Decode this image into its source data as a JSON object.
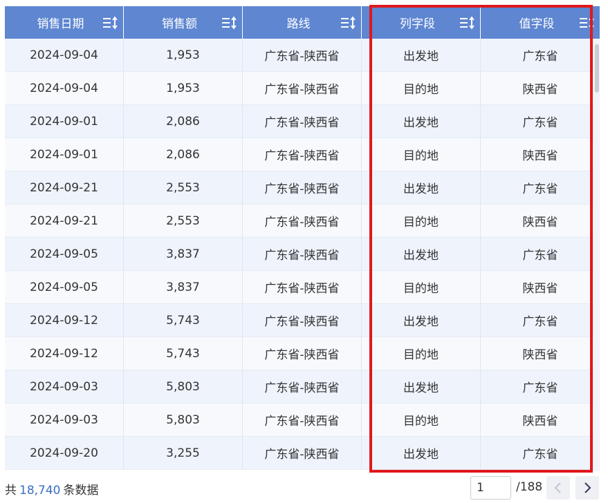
{
  "table": {
    "columns": [
      {
        "label": "销售日期",
        "sort_icon": "sort-icon"
      },
      {
        "label": "销售额",
        "sort_icon": "sort-icon"
      },
      {
        "label": "路线",
        "sort_icon": "sort-icon"
      },
      {
        "label": "列字段",
        "sort_icon": "sort-icon"
      },
      {
        "label": "值字段",
        "sort_icon": "sort-icon"
      }
    ],
    "rows": [
      [
        "2024-09-04",
        "1,953",
        "广东省-陕西省",
        "出发地",
        "广东省"
      ],
      [
        "2024-09-04",
        "1,953",
        "广东省-陕西省",
        "目的地",
        "陕西省"
      ],
      [
        "2024-09-01",
        "2,086",
        "广东省-陕西省",
        "出发地",
        "广东省"
      ],
      [
        "2024-09-01",
        "2,086",
        "广东省-陕西省",
        "目的地",
        "陕西省"
      ],
      [
        "2024-09-21",
        "2,553",
        "广东省-陕西省",
        "出发地",
        "广东省"
      ],
      [
        "2024-09-21",
        "2,553",
        "广东省-陕西省",
        "目的地",
        "陕西省"
      ],
      [
        "2024-09-05",
        "3,837",
        "广东省-陕西省",
        "出发地",
        "广东省"
      ],
      [
        "2024-09-05",
        "3,837",
        "广东省-陕西省",
        "目的地",
        "陕西省"
      ],
      [
        "2024-09-12",
        "5,743",
        "广东省-陕西省",
        "出发地",
        "广东省"
      ],
      [
        "2024-09-12",
        "5,743",
        "广东省-陕西省",
        "目的地",
        "陕西省"
      ],
      [
        "2024-09-03",
        "5,803",
        "广东省-陕西省",
        "出发地",
        "广东省"
      ],
      [
        "2024-09-03",
        "5,803",
        "广东省-陕西省",
        "目的地",
        "陕西省"
      ],
      [
        "2024-09-20",
        "3,255",
        "广东省-陕西省",
        "出发地",
        "广东省"
      ]
    ]
  },
  "footer": {
    "total_prefix": "共",
    "total_count": "18,740",
    "total_suffix": "条数据",
    "current_page": "1",
    "page_total": "/188",
    "prev_icon": "chevron-left-icon",
    "next_icon": "chevron-right-icon"
  },
  "colors": {
    "header_bg": "#5e86d1",
    "row_odd": "#eef3fc",
    "row_even": "#f7f9fd",
    "highlight_border": "#e0181c",
    "count_text": "#3a6fc4"
  }
}
